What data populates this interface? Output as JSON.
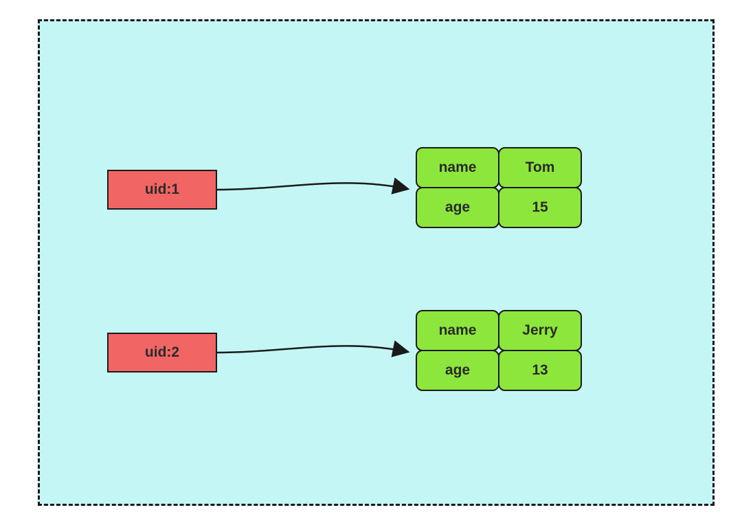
{
  "entries": [
    {
      "key": "uid:1",
      "fields": [
        {
          "label": "name",
          "value": "Tom"
        },
        {
          "label": "age",
          "value": "15"
        }
      ]
    },
    {
      "key": "uid:2",
      "fields": [
        {
          "label": "name",
          "value": "Jerry"
        },
        {
          "label": "age",
          "value": "13"
        }
      ]
    }
  ],
  "colors": {
    "background": "#c5f6f6",
    "key_box": "#f16565",
    "value_cell": "#8ce63b",
    "border": "#1a1a1a"
  }
}
